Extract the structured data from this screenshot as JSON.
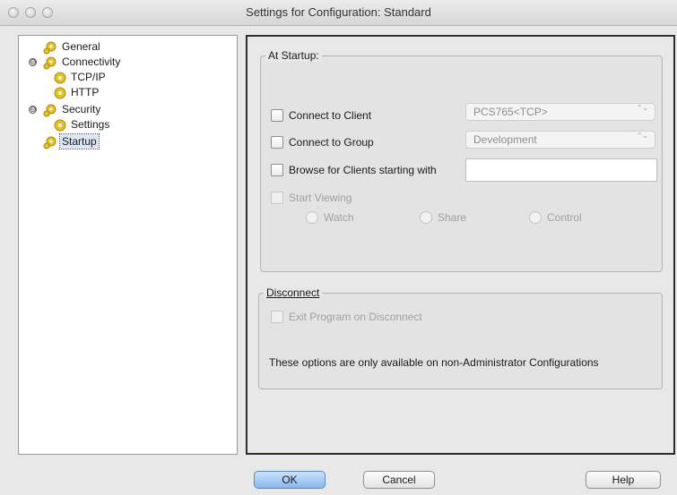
{
  "window": {
    "title": "Settings for Configuration: Standard"
  },
  "tree": {
    "items": [
      {
        "label": "General"
      },
      {
        "label": "Connectivity",
        "expander": "⊖"
      },
      {
        "label": "TCP/IP"
      },
      {
        "label": "HTTP"
      },
      {
        "label": "Security",
        "expander": "⊖"
      },
      {
        "label": "Settings"
      },
      {
        "label": "Startup"
      }
    ]
  },
  "startup_group": {
    "legend": "At Startup:",
    "connect_client": {
      "label": "Connect to Client",
      "select_value": "PCS765<TCP>"
    },
    "connect_group": {
      "label": "Connect to Group",
      "select_value": "Development"
    },
    "browse_clients": {
      "label": "Browse for Clients starting with",
      "value": ""
    },
    "start_viewing": {
      "label": "Start Viewing"
    },
    "radios": {
      "watch": "Watch",
      "share": "Share",
      "control": "Control"
    }
  },
  "disconnect_group": {
    "legend": "Disconnect",
    "exit_program": {
      "label": "Exit Program on Disconnect"
    },
    "note": "These options are only available on non-Administrator Configurations"
  },
  "buttons": {
    "ok": "OK",
    "cancel": "Cancel",
    "help": "Help"
  },
  "icons": {
    "select_arrows": "⌃⌄"
  },
  "colors": {
    "default_button": "#86b8ee",
    "selection": "#dbe6f7",
    "gear_icon": "#e8c21c"
  }
}
